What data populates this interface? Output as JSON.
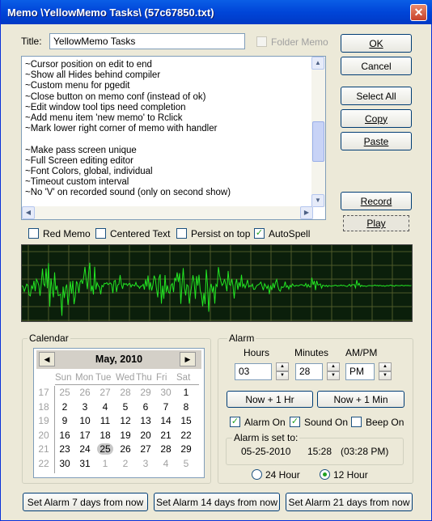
{
  "window": {
    "title": "Memo \\YellowMemo Tasks\\ (57c67850.txt)",
    "close": "✕"
  },
  "title_field": {
    "label": "Title:",
    "value": "YellowMemo Tasks"
  },
  "folder_memo": {
    "label": "Folder Memo"
  },
  "memo_lines": "~Cursor position on edit to end\n~Show all Hides behind compiler\n~Custom menu for pgedit\n~Close button on memo conf (instead of ok)\n~Edit window tool tips need completion\n~Add menu item 'new memo' to Rclick\n~Mark lower right corner of memo with handler\n\n~Make pass screen unique\n~Full Screen editing editor\n~Font Colors, global, individual\n~Timeout custom interval\n~No 'V' on recorded sound (only on second show)",
  "buttons": {
    "ok": "OK",
    "cancel": "Cancel",
    "select_all": "Select All",
    "copy": "Copy",
    "paste": "Paste",
    "record": "Record",
    "play": "Play"
  },
  "options": {
    "red_memo": "Red Memo",
    "centered": "Centered Text",
    "persist": "Persist on top",
    "autospell": "AutoSpell"
  },
  "calendar": {
    "group": "Calendar",
    "month": "May, 2010",
    "dow": [
      "Sun",
      "Mon",
      "Tue",
      "Wed",
      "Thu",
      "Fri",
      "Sat"
    ],
    "weeks": [
      [
        "17",
        "25",
        "26",
        "27",
        "28",
        "29",
        "30",
        "1"
      ],
      [
        "18",
        "2",
        "3",
        "4",
        "5",
        "6",
        "7",
        "8"
      ],
      [
        "19",
        "9",
        "10",
        "11",
        "12",
        "13",
        "14",
        "15"
      ],
      [
        "20",
        "16",
        "17",
        "18",
        "19",
        "20",
        "21",
        "22"
      ],
      [
        "21",
        "23",
        "24",
        "25",
        "26",
        "27",
        "28",
        "29"
      ],
      [
        "22",
        "30",
        "31",
        "1",
        "2",
        "3",
        "4",
        "5"
      ]
    ]
  },
  "alarm": {
    "group": "Alarm",
    "hours_label": "Hours",
    "minutes_label": "Minutes",
    "ampm_label": "AM/PM",
    "hours": "03",
    "minutes": "28",
    "ampm": "PM",
    "now_plus_hr": "Now + 1 Hr",
    "now_plus_min": "Now + 1 Min",
    "alarm_on": "Alarm On",
    "sound_on": "Sound On",
    "beep_on": "Beep On",
    "set_to_label": "Alarm is set to:",
    "set_date": "05-25-2010",
    "set_time": "15:28",
    "set_time12": "(03:28  PM)",
    "hour24": "24 Hour",
    "hour12": "12 Hour"
  },
  "footer": {
    "days7": "Set Alarm 7 days from now",
    "days14": "Set Alarm 14 days from now",
    "days21": "Set Alarm 21 days from now"
  },
  "colors": {
    "wave": "#23e623",
    "grid": "#4e5a2a",
    "accent": "#0045d8"
  }
}
